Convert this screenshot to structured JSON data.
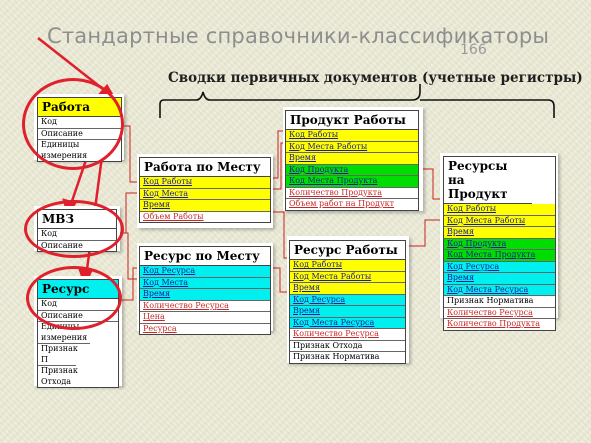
{
  "slide": {
    "title": "Стандартные справочники-классификаторы",
    "page_number": "166",
    "subtitle": "Сводки первичных документов (учетные регистры)"
  },
  "left_tables": {
    "rabota": {
      "header": "Работа",
      "rows": [
        "Код",
        "Описание",
        "Единицы измерения"
      ]
    },
    "mvz": {
      "header": "МВЗ",
      "rows": [
        "Код",
        "Описание"
      ]
    },
    "resurs": {
      "header": "Ресурс",
      "rows": [
        "Код",
        "Описание",
        "Единицы измерения",
        "Признак П",
        "Признак Отхода"
      ]
    }
  },
  "registers": {
    "rabota_po_mestu": {
      "header": "Работа по Месту",
      "rows": [
        "Код Работы",
        "Код Места",
        "Время",
        "Объем Работы"
      ]
    },
    "produkt_raboty": {
      "header": "Продукт Работы",
      "rows": [
        "Код Работы",
        "Код Места Работы",
        "Время",
        "Код Продукта",
        "Код Места Продукта",
        "Количество Продукта",
        "Объем работ на Продукт"
      ]
    },
    "resurs_po_mestu": {
      "header": "Ресурс по Месту",
      "rows": [
        "Код Ресурса",
        "Код Места",
        "Время",
        "Количество Ресурса",
        "Цена",
        "Ресурса"
      ]
    },
    "resurs_raboty": {
      "header": "Ресурс Работы",
      "rows": [
        "Код Работы",
        "Код Места Работы",
        "Время",
        "Код Ресурса",
        "Время",
        "Код Места Ресурса",
        "Количество Ресурса",
        "Признак Отхода",
        "Признак Норматива"
      ]
    },
    "resursy_na_produkt": {
      "header": "Ресурсы на Продукт",
      "rows": [
        "Код Работы",
        "Код Места Работы",
        "Время",
        "Код Продукта",
        "Код Места Продукта",
        "Код Ресурса",
        "Время",
        "Код Места Ресурса",
        "Признак Норматива",
        "Количество Ресурса",
        "Количество Продукта"
      ]
    }
  },
  "colors": {
    "yellow": "#ffff00",
    "green": "#00dd00",
    "cyan": "#00f0f0",
    "red_ring": "#e0202c",
    "link_red": "#cc2020"
  }
}
